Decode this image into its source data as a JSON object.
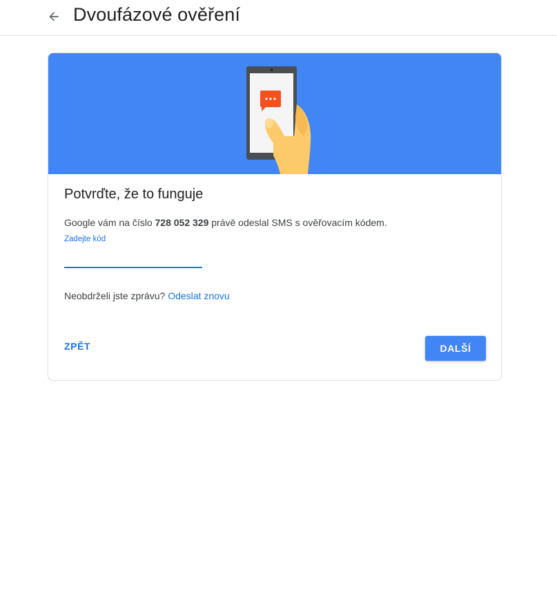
{
  "header": {
    "title": "Dvoufázové ověření",
    "back_icon": "arrow-left-icon"
  },
  "card": {
    "illustration_icon": "phone-sms-illustration",
    "title": "Potvrďte, že to funguje",
    "desc_prefix": "Google vám na číslo ",
    "phone_number": "728 052 329",
    "desc_suffix": " právě odeslal SMS s ověřovacím kódem.",
    "code_label": "Zadejte kód",
    "code_value": "",
    "resend_prompt": "Neobdrželi jste zprávu? ",
    "resend_link": "Odeslat znovu",
    "back_label": "ZPĚT",
    "next_label": "DALŠÍ"
  },
  "colors": {
    "banner": "#4285f4",
    "accent": "#1a73e8",
    "sms_bubble": "#f4511e"
  }
}
